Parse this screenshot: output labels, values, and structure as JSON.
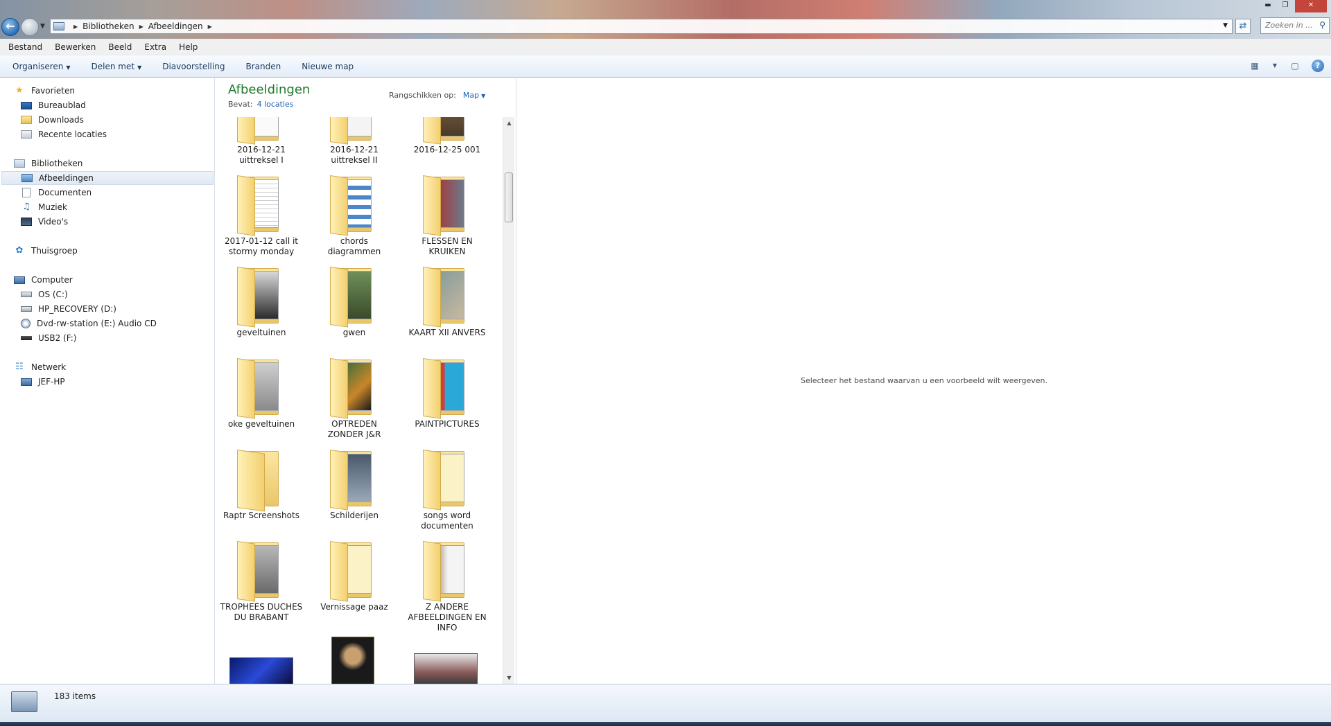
{
  "address": {
    "crumbs": [
      "Bibliotheken",
      "Afbeeldingen"
    ],
    "search_placeholder": "Zoeken in ..."
  },
  "menu": [
    "Bestand",
    "Bewerken",
    "Beeld",
    "Extra",
    "Help"
  ],
  "commands": {
    "organize": "Organiseren",
    "share": "Delen met",
    "slideshow": "Diavoorstelling",
    "burn": "Branden",
    "new_folder": "Nieuwe map"
  },
  "nav": {
    "favorites": "Favorieten",
    "desktop": "Bureaublad",
    "downloads": "Downloads",
    "recent": "Recente locaties",
    "libraries": "Bibliotheken",
    "pictures": "Afbeeldingen",
    "documents": "Documenten",
    "music": "Muziek",
    "videos": "Video's",
    "homegroup": "Thuisgroep",
    "computer": "Computer",
    "drive_c": "OS (C:)",
    "drive_d": "HP_RECOVERY (D:)",
    "drive_e": "Dvd-rw-station (E:) Audio CD",
    "drive_f": "USB2 (F:)",
    "network": "Netwerk",
    "net_host": "JEF-HP"
  },
  "library": {
    "title": "Afbeeldingen",
    "contains_label": "Bevat:",
    "contains_link": "4 locaties",
    "arrange_label": "Rangschikken op:",
    "arrange_value": "Map"
  },
  "items": [
    {
      "label": "2016-12-21 uittreksel I"
    },
    {
      "label": "2016-12-21 uittreksel II"
    },
    {
      "label": "2016-12-25 001"
    },
    {
      "label": "2017-01-12 call it stormy monday"
    },
    {
      "label": "chords diagrammen"
    },
    {
      "label": "FLESSEN EN KRUIKEN"
    },
    {
      "label": "geveltuinen"
    },
    {
      "label": "gwen"
    },
    {
      "label": "KAART XII ANVERS"
    },
    {
      "label": "oke geveltuinen"
    },
    {
      "label": "OPTREDEN ZONDER J&R"
    },
    {
      "label": "PAINTPICTURES"
    },
    {
      "label": "Raptr Screenshots"
    },
    {
      "label": "Schilderijen"
    },
    {
      "label": "songs word documenten"
    },
    {
      "label": "TROPHEES DUCHES DU BRABANT"
    },
    {
      "label": "Vernissage paaz"
    },
    {
      "label": "Z ANDERE AFBEELDINGEN EN INFO"
    }
  ],
  "preview": {
    "message": "Selecteer het bestand waarvan u een voorbeeld wilt weergeven."
  },
  "status": {
    "count": "183 items"
  }
}
